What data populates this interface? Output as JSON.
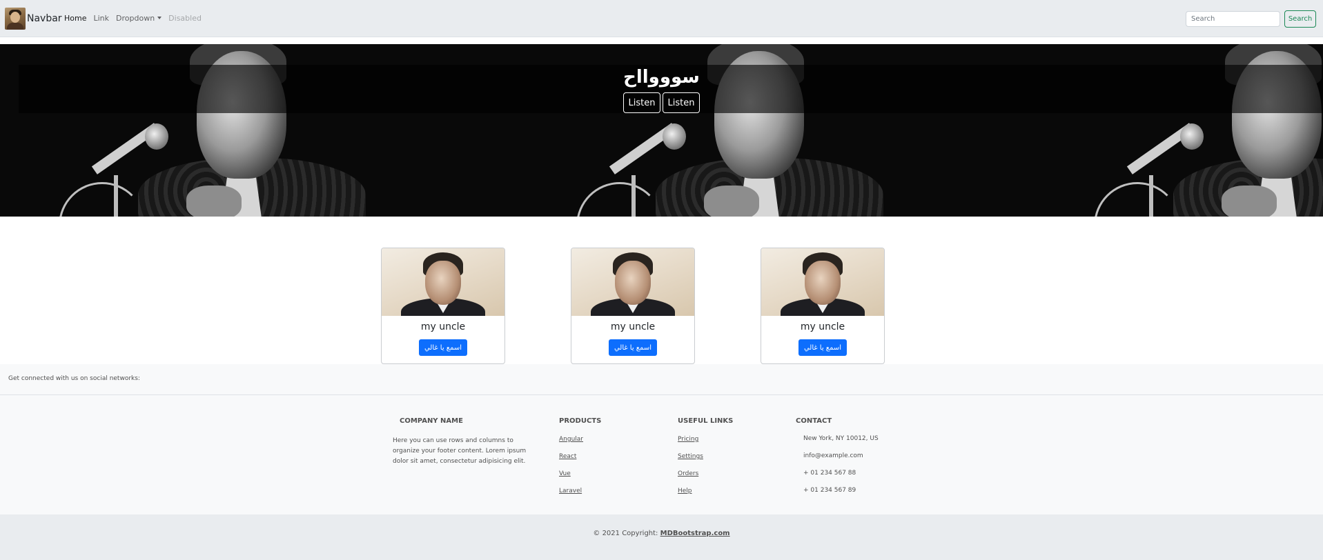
{
  "navbar": {
    "brand": "Navbar",
    "items": [
      {
        "label": "Home",
        "state": "active"
      },
      {
        "label": "Link",
        "state": "normal"
      },
      {
        "label": "Dropdown",
        "state": "normal"
      },
      {
        "label": "Disabled",
        "state": "disabled"
      }
    ],
    "search_placeholder": "Search",
    "search_button": "Search"
  },
  "hero": {
    "title": "سوووااح",
    "buttons": [
      "Listen",
      "Listen"
    ]
  },
  "cards": [
    {
      "title": "my uncle",
      "button": "اسمع يا غالي"
    },
    {
      "title": "my uncle",
      "button": "اسمع يا غالي"
    },
    {
      "title": "my uncle",
      "button": "اسمع يا غالي"
    }
  ],
  "footer": {
    "social_text": "Get connected with us on social networks:",
    "company": {
      "heading": "Company name",
      "text": [
        "Here you can use rows and columns to",
        "organize your footer content. Lorem ipsum",
        "dolor sit amet, consectetur adipisicing elit."
      ]
    },
    "products": {
      "heading": "Products",
      "links": [
        "Angular",
        "React",
        "Vue",
        "Laravel"
      ]
    },
    "useful_links": {
      "heading": "Useful links",
      "links": [
        "Pricing",
        "Settings",
        "Orders",
        "Help"
      ]
    },
    "contact": {
      "heading": "Contact",
      "items": [
        "New York, NY 10012, US",
        "info@example.com",
        "+ 01 234 567 88",
        "+ 01 234 567 89"
      ]
    }
  },
  "copyright": {
    "prefix": "© 2021 Copyright:",
    "link": "MDBootstrap.com"
  },
  "colors": {
    "primary": "#0d6efd",
    "success": "#198754",
    "navbar_bg": "#e9ecef",
    "footer_bg": "#f8f9fa"
  }
}
